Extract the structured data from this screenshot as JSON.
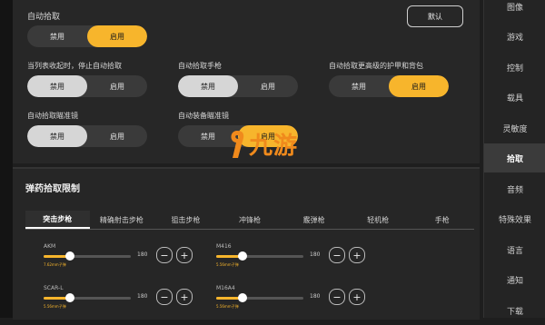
{
  "header": {
    "default_label": "默认"
  },
  "settings": {
    "auto_pickup": {
      "label": "自动拾取",
      "options": [
        "禁用",
        "启用"
      ],
      "selected": "启用"
    },
    "stop_on_list": {
      "label": "当列表收起时，停止自动拾取",
      "options": [
        "禁用",
        "启用"
      ],
      "selected": "禁用"
    },
    "auto_pickup_pistol": {
      "label": "自动拾取手枪",
      "options": [
        "禁用",
        "启用"
      ],
      "selected": "禁用"
    },
    "pickup_higher_armor": {
      "label": "自动拾取更高级的护甲和背包",
      "options": [
        "禁用",
        "启用"
      ],
      "selected": "启用"
    },
    "pickup_scope": {
      "label": "自动拾取瞄准镜",
      "options": [
        "禁用",
        "启用"
      ],
      "selected": "禁用"
    },
    "equip_scope": {
      "label": "自动装备瞄准镜",
      "options": [
        "禁用",
        "启用"
      ],
      "selected": "启用"
    }
  },
  "ammo": {
    "title": "弹药拾取限制",
    "tabs": [
      "突击步枪",
      "精确射击步枪",
      "狙击步枪",
      "冲锋枪",
      "霰弹枪",
      "轻机枪",
      "手枪"
    ],
    "active_tab": "突击步枪",
    "weapons": [
      {
        "name": "AKM",
        "max": "180",
        "level": 0.3,
        "sub": "7.62mm子弹"
      },
      {
        "name": "M416",
        "max": "180",
        "level": 0.3,
        "sub": "5.56mm子弹"
      },
      {
        "name": "SCAR-L",
        "max": "180",
        "level": 0.3,
        "sub": "5.56mm子弹"
      },
      {
        "name": "M16A4",
        "max": "180",
        "level": 0.3,
        "sub": "5.56mm子弹"
      }
    ],
    "minus": "−",
    "plus": "+"
  },
  "sidebar": {
    "items": [
      "图像",
      "游戏",
      "控制",
      "载具",
      "灵敏度",
      "拾取",
      "音频",
      "特殊效果",
      "语言",
      "通知",
      "下载"
    ],
    "active": "拾取"
  },
  "watermark": {
    "text": "九游"
  },
  "colors": {
    "accent": "#f7b52c",
    "panel": "#272727",
    "active_option": "#d6d6d6"
  },
  "icons": [
    "minus-icon",
    "plus-icon",
    "jiuyou-logo-icon"
  ]
}
